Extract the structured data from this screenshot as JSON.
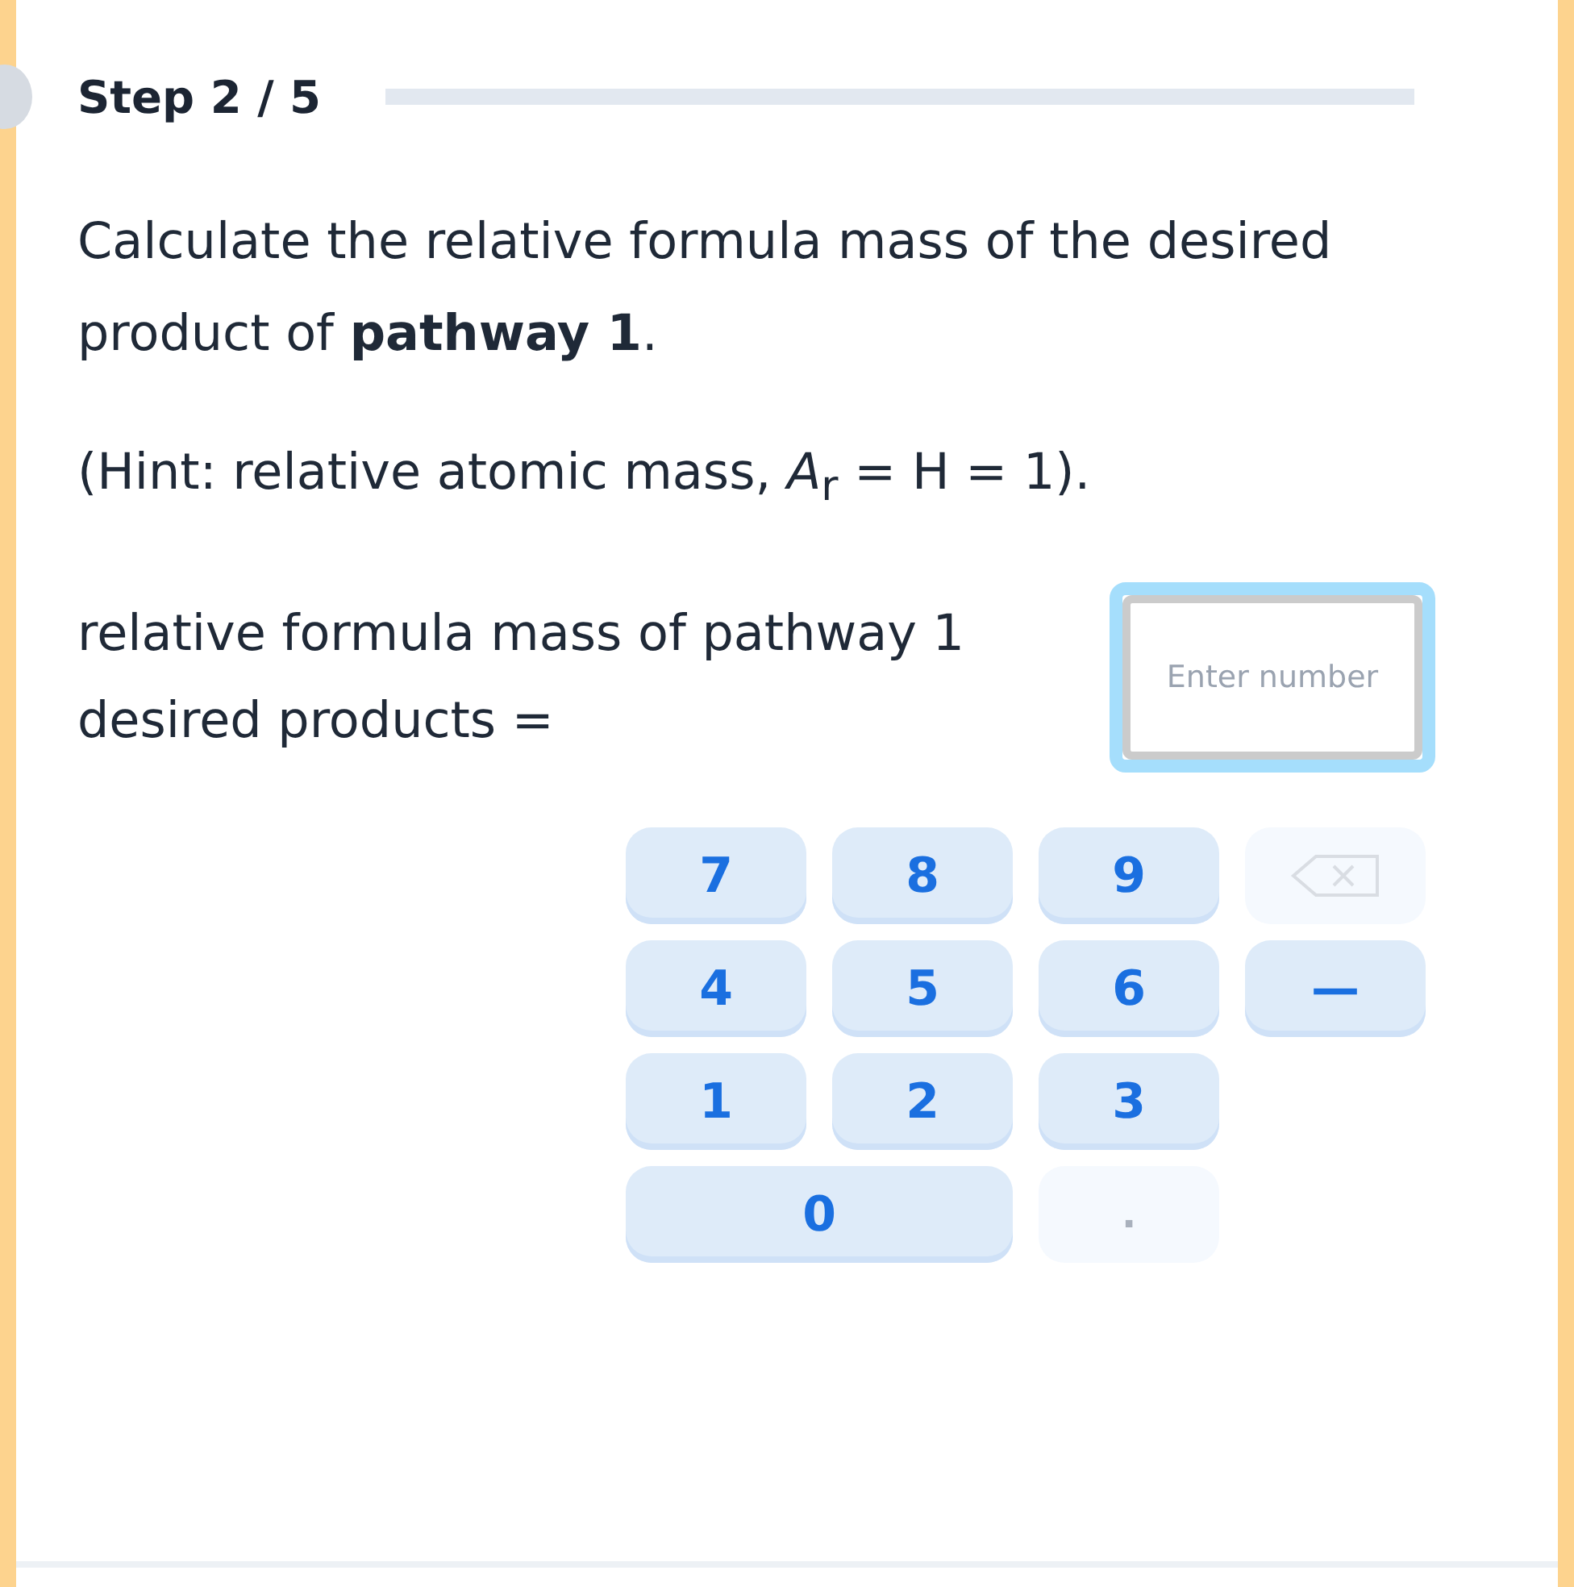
{
  "header": {
    "step": "Step 2 / 5"
  },
  "question": {
    "prompt": "Calculate the relative formula mass of the desired product of **pathway 1**.",
    "hint": "(Hint: relative atomic mass, *A*$_{r}$ = H = 1)."
  },
  "answer": {
    "label": "relative formula mass of pathway 1 desired products =",
    "placeholder": "Enter number"
  },
  "keypad": [
    {
      "kind": "digit",
      "label": "7",
      "disabled": false
    },
    {
      "kind": "digit",
      "label": "8",
      "disabled": false
    },
    {
      "kind": "digit",
      "label": "9",
      "disabled": false
    },
    {
      "kind": "backspace",
      "disabled": true
    },
    {
      "kind": "digit",
      "label": "4",
      "disabled": false
    },
    {
      "kind": "digit",
      "label": "5",
      "disabled": false
    },
    {
      "kind": "digit",
      "label": "6",
      "disabled": false
    },
    {
      "kind": "minus",
      "label": "—",
      "disabled": false
    },
    {
      "kind": "digit",
      "label": "1",
      "disabled": false
    },
    {
      "kind": "digit",
      "label": "2",
      "disabled": false
    },
    {
      "kind": "digit",
      "label": "3",
      "disabled": false
    },
    {
      "kind": "gap"
    },
    {
      "kind": "zero",
      "label": "0",
      "disabled": false
    },
    {
      "kind": "point",
      "label": ".",
      "disabled": true
    }
  ]
}
